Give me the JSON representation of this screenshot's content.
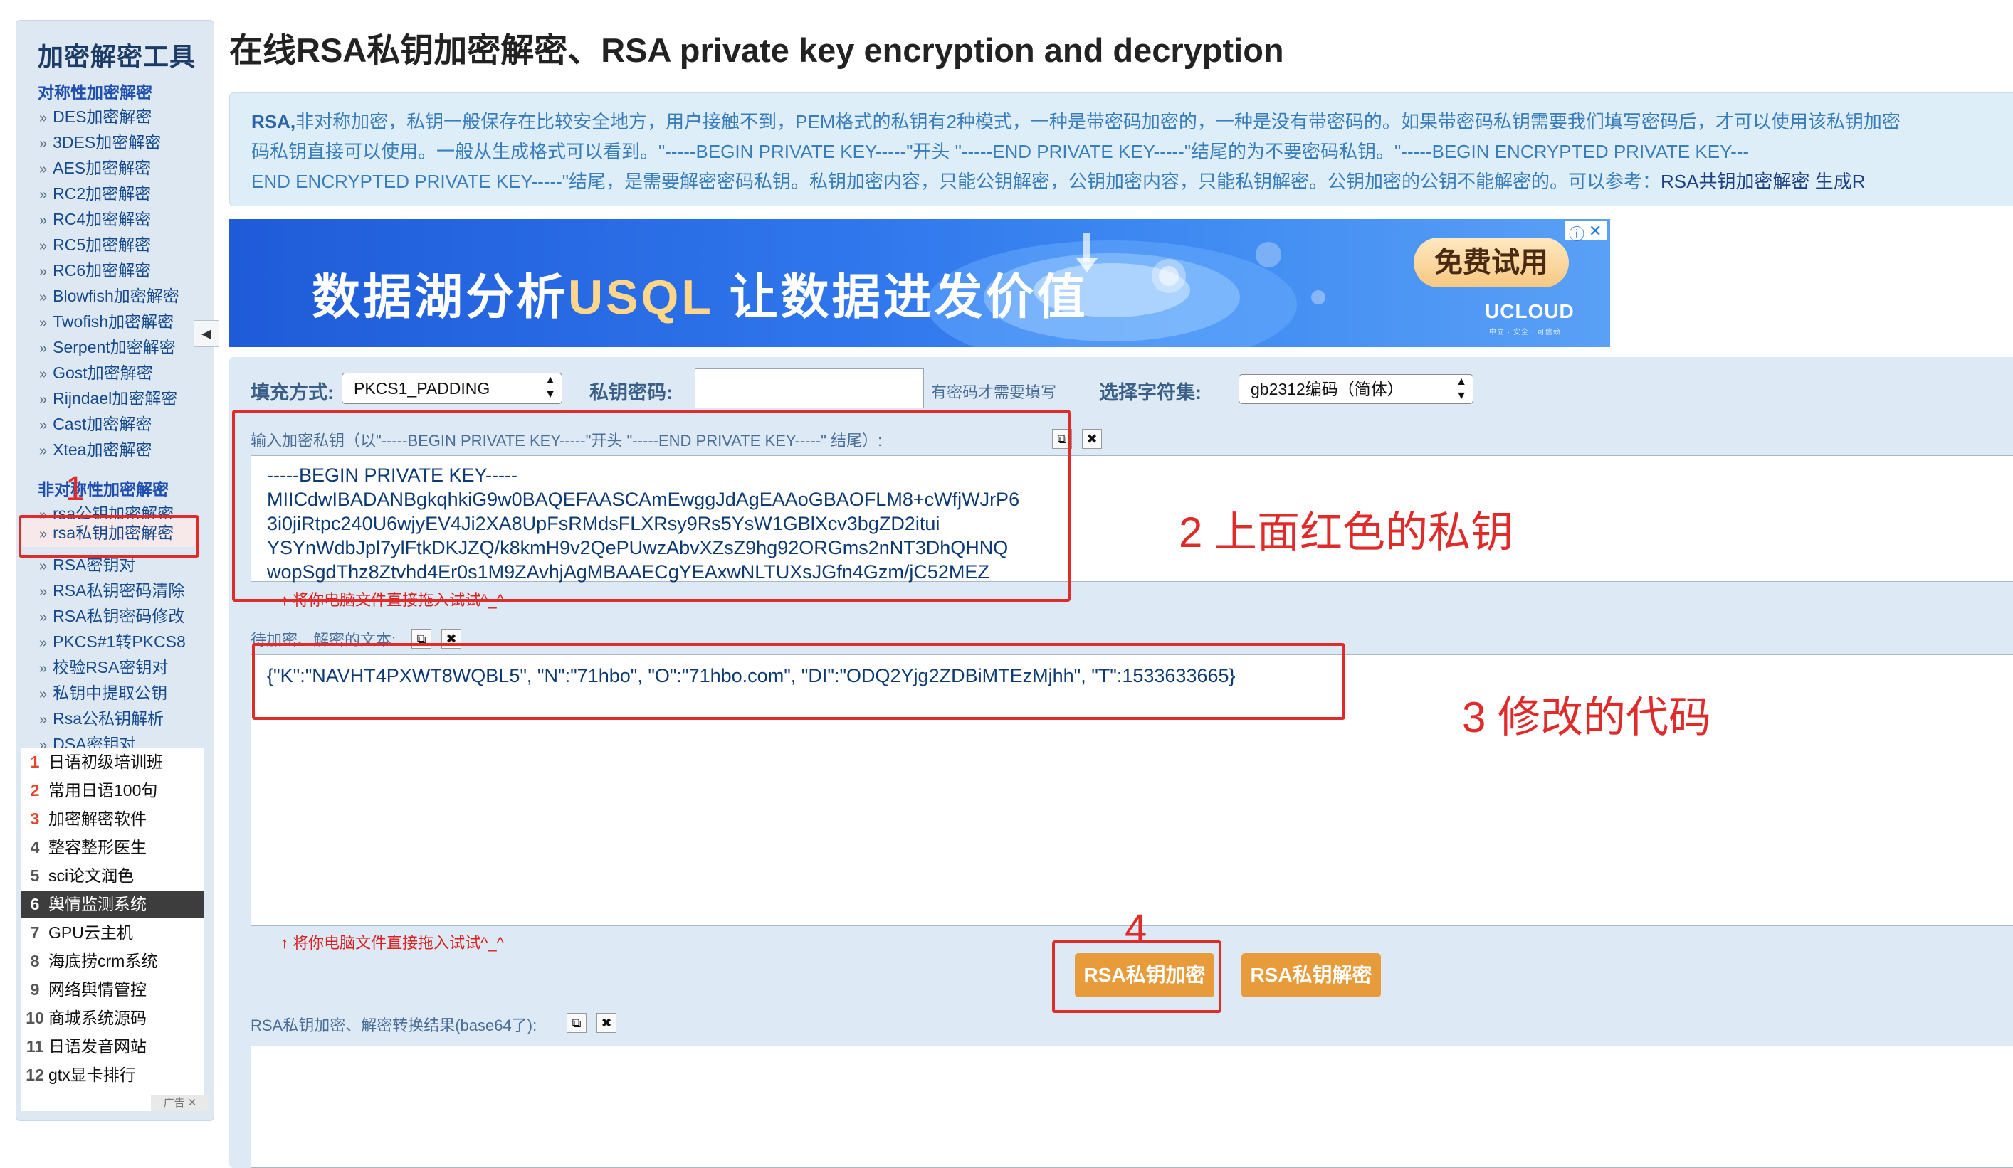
{
  "sidebar": {
    "title": "加密解密工具",
    "section_symmetric": "对称性加密解密",
    "symmetric_items": [
      "DES加密解密",
      "3DES加密解密",
      "AES加密解密",
      "RC2加密解密",
      "RC4加密解密",
      "RC5加密解密",
      "RC6加密解密",
      "Blowfish加密解密",
      "Twofish加密解密",
      "Serpent加密解密",
      "Gost加密解密",
      "Rijndael加密解密",
      "Cast加密解密",
      "Xtea加密解密"
    ],
    "section_asymmetric": "非对称性加密解密",
    "asymmetric_items": [
      "rsa公钥加密解密",
      "rsa私钥加密解密",
      "RSA密钥对",
      "RSA私钥密码清除",
      "RSA私钥密码修改",
      "PKCS#1转PKCS8",
      "校验RSA密钥对",
      "私钥中提取公钥",
      "Rsa公私钥解析",
      "DSA密钥对"
    ],
    "collapse_glyph": "◀",
    "ranked_list": [
      {
        "num": "1",
        "label": "日语初级培训班"
      },
      {
        "num": "2",
        "label": "常用日语100句"
      },
      {
        "num": "3",
        "label": "加密解密软件"
      },
      {
        "num": "4",
        "label": "整容整形医生"
      },
      {
        "num": "5",
        "label": "sci论文润色"
      },
      {
        "num": "6",
        "label": "舆情监测系统"
      },
      {
        "num": "7",
        "label": "GPU云主机"
      },
      {
        "num": "8",
        "label": "海底捞crm系统"
      },
      {
        "num": "9",
        "label": "网络舆情管控"
      },
      {
        "num": "10",
        "label": "商城系统源码"
      },
      {
        "num": "11",
        "label": "日语发音网站"
      },
      {
        "num": "12",
        "label": "gtx显卡排行"
      }
    ],
    "ad_tag": "广告 ✕"
  },
  "page_title": "在线RSA私钥加密解密、RSA private key encryption and decryption",
  "intro": {
    "line1_lead": "RSA,",
    "line1": "非对称加密，私钥一般保存在比较安全地方，用户接触不到，PEM格式的私钥有2种模式，一种是带密码加密的，一种是没有带密码的。如果带密码私钥需要我们填写密码后，才可以使用该私钥加密",
    "line2": "码私钥直接可以使用。一般从生成格式可以看到。\"-----BEGIN PRIVATE KEY-----\"开头 \"-----END PRIVATE KEY-----\"结尾的为不要密码私钥。\"-----BEGIN ENCRYPTED PRIVATE KEY---",
    "line3": "END ENCRYPTED PRIVATE KEY-----\"结尾，是需要解密密码私钥。私钥加密内容，只能公钥解密，公钥加密内容，只能私钥解密。公钥加密的公钥不能解密的。可以参考：",
    "line3_links": "RSA共钥加密解密 生成R"
  },
  "ad": {
    "headline_a": "数据湖分析",
    "headline_b": "USQL",
    "headline_c": "  让数据进发价值",
    "cta": "免费试用",
    "brand": "UCLOUD",
    "brand_sub": "中立 · 安全 · 可信赖",
    "info_glyph": "ⓘ",
    "close_glyph": "✕"
  },
  "form": {
    "padding_label": "填充方式:",
    "padding_value": "PKCS1_PADDING",
    "password_label": "私钥密码:",
    "password_value": "",
    "password_hint": "有密码才需要填写",
    "charset_label": "选择字符集:",
    "charset_value": "gb2312编码（简体）",
    "key_label": "输入加密私钥（以\"-----BEGIN PRIVATE KEY-----\"开头 \"-----END PRIVATE KEY-----\" 结尾）:",
    "key_lines": [
      "-----BEGIN PRIVATE KEY-----",
      "MIICdwIBADANBgkqhkiG9w0BAQEFAASCAmEwggJdAgEAAoGBAOFLM8+cWfjWJrP6",
      "3i0jiRtpc240U6wjyEV4Ji2XA8UpFsRMdsFLXRsy9Rs5YsW1GBlXcv3bgZD2itui",
      "YSYnWdbJpl7ylFtkDKJZQ/k8kmH9v2QePUwzAbvXZsZ9hg92ORGms2nNT3DhQHNQ",
      "wopSgdThz8Ztvhd4Er0s1M9ZAvhjAgMBAAECgYEAxwNLTUXsJGfn4Gzm/jC52MEZ"
    ],
    "drop_hint": "↑ 将你电脑文件直接拖入试试^_^",
    "text_label": "待加密、解密的文本:",
    "text_value": "{\"K\":\"NAVHT4PXWT8WQBL5\", \"N\":\"71hbo\", \"O\":\"71hbo.com\", \"DI\":\"ODQ2Yjg2ZDBiMTEzMjhh\", \"T\":1533633665}",
    "encrypt_button": "RSA私钥加密",
    "decrypt_button": "RSA私钥解密",
    "result_label": "RSA私钥加密、解密转换结果(base64了):",
    "copy_glyph": "⧉",
    "clear_glyph": "✖"
  },
  "annotations": {
    "label_1": "1",
    "label_2": "2 上面红色的私钥",
    "label_3": "3 修改的代码",
    "label_4": "4",
    "color": "#e02b2b"
  }
}
